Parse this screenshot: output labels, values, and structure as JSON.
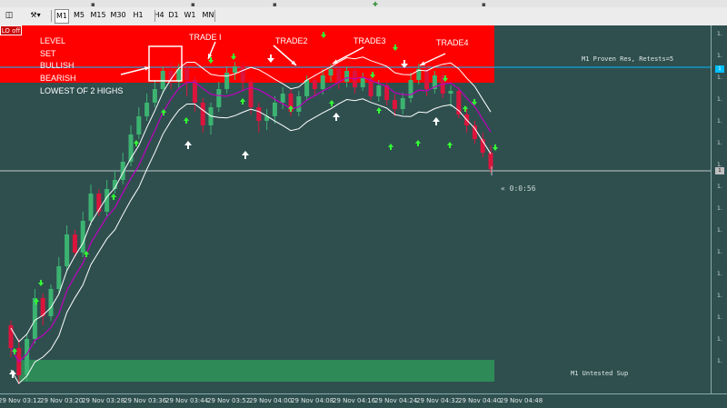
{
  "toolbar": {
    "timeframes": [
      "M1",
      "M5",
      "M15",
      "M30",
      "H1",
      "H4",
      "D1",
      "W1",
      "MN"
    ],
    "active": "M1"
  },
  "solo_button": {
    "label": "LO off"
  },
  "labels": {
    "level": "LEVEL",
    "set": "SET",
    "bullish": "BULLISH",
    "bearish": "BEARISH",
    "lowest": "LOWEST OF 2 HIGHS",
    "trade1": "TRADE I",
    "trade2": "TRADE2",
    "trade3": "TRADE3",
    "trade4": "TRADE4"
  },
  "zones": {
    "resistance_label": "M1 Proven Res, Retests=5",
    "support_label": "M1 Untested Sup",
    "timer": "« 0:0:56"
  },
  "price_axis": {
    "labels": [
      "1.",
      "1.",
      "1.",
      "1.",
      "1.",
      "1.",
      "1.",
      "1.",
      "1.",
      "1.",
      "1.",
      "1.",
      "1.",
      "1.",
      "1.",
      "1."
    ]
  },
  "time_axis": {
    "labels": [
      "29 Nov 03:12",
      "29 Nov 03:20",
      "29 Nov 03:28",
      "29 Nov 03:36",
      "29 Nov 03:44",
      "29 Nov 03:52",
      "29 Nov 04:00",
      "29 Nov 04:08",
      "29 Nov 04:16",
      "29 Nov 04:24",
      "29 Nov 04:32",
      "29 Nov 04:40",
      "29 Nov 04:48"
    ]
  },
  "colors": {
    "background": "#2f4f4f",
    "bull": "#3cb371",
    "bear": "#dc143c",
    "resistance": "#ff0000",
    "support": "#2e8b57",
    "band": "#ffffff",
    "mid": "#c000c0",
    "cyan": "#00bfff"
  },
  "chart_data": {
    "type": "candlestick",
    "candles": [
      {
        "o": 330,
        "c": 355,
        "h": 325,
        "l": 365
      },
      {
        "o": 355,
        "c": 385,
        "h": 345,
        "l": 395
      },
      {
        "o": 385,
        "c": 345,
        "h": 340,
        "l": 392
      },
      {
        "o": 345,
        "c": 300,
        "h": 290,
        "l": 350
      },
      {
        "o": 300,
        "c": 320,
        "h": 295,
        "l": 330
      },
      {
        "o": 320,
        "c": 290,
        "h": 285,
        "l": 325
      },
      {
        "o": 290,
        "c": 265,
        "h": 255,
        "l": 295
      },
      {
        "o": 265,
        "c": 230,
        "h": 220,
        "l": 270
      },
      {
        "o": 230,
        "c": 250,
        "h": 225,
        "l": 255
      },
      {
        "o": 250,
        "c": 215,
        "h": 205,
        "l": 255
      },
      {
        "o": 215,
        "c": 185,
        "h": 175,
        "l": 220
      },
      {
        "o": 185,
        "c": 205,
        "h": 180,
        "l": 210
      },
      {
        "o": 205,
        "c": 180,
        "h": 170,
        "l": 210
      },
      {
        "o": 180,
        "c": 170,
        "h": 160,
        "l": 185
      },
      {
        "o": 170,
        "c": 150,
        "h": 140,
        "l": 175
      },
      {
        "o": 150,
        "c": 120,
        "h": 110,
        "l": 155
      },
      {
        "o": 120,
        "c": 100,
        "h": 90,
        "l": 125
      },
      {
        "o": 100,
        "c": 85,
        "h": 75,
        "l": 105
      },
      {
        "o": 85,
        "c": 70,
        "h": 60,
        "l": 90
      },
      {
        "o": 70,
        "c": 50,
        "h": 45,
        "l": 75
      },
      {
        "o": 50,
        "c": 62,
        "h": 40,
        "l": 70
      },
      {
        "o": 62,
        "c": 48,
        "h": 42,
        "l": 70
      },
      {
        "o": 48,
        "c": 60,
        "h": 40,
        "l": 78
      },
      {
        "o": 60,
        "c": 85,
        "h": 55,
        "l": 95
      },
      {
        "o": 85,
        "c": 110,
        "h": 80,
        "l": 118
      },
      {
        "o": 110,
        "c": 90,
        "h": 85,
        "l": 120
      },
      {
        "o": 90,
        "c": 70,
        "h": 62,
        "l": 95
      },
      {
        "o": 70,
        "c": 52,
        "h": 45,
        "l": 75
      },
      {
        "o": 52,
        "c": 45,
        "h": 40,
        "l": 60
      },
      {
        "o": 45,
        "c": 62,
        "h": 40,
        "l": 72
      },
      {
        "o": 62,
        "c": 90,
        "h": 58,
        "l": 98
      },
      {
        "o": 90,
        "c": 105,
        "h": 85,
        "l": 118
      },
      {
        "o": 105,
        "c": 100,
        "h": 92,
        "l": 115
      },
      {
        "o": 100,
        "c": 85,
        "h": 78,
        "l": 108
      },
      {
        "o": 85,
        "c": 75,
        "h": 68,
        "l": 92
      },
      {
        "o": 75,
        "c": 95,
        "h": 70,
        "l": 100
      },
      {
        "o": 95,
        "c": 78,
        "h": 72,
        "l": 100
      },
      {
        "o": 78,
        "c": 60,
        "h": 55,
        "l": 82
      },
      {
        "o": 60,
        "c": 70,
        "h": 52,
        "l": 78
      },
      {
        "o": 70,
        "c": 55,
        "h": 48,
        "l": 76
      },
      {
        "o": 55,
        "c": 48,
        "h": 42,
        "l": 62
      },
      {
        "o": 48,
        "c": 62,
        "h": 44,
        "l": 70
      },
      {
        "o": 62,
        "c": 50,
        "h": 45,
        "l": 68
      },
      {
        "o": 50,
        "c": 68,
        "h": 46,
        "l": 75
      },
      {
        "o": 68,
        "c": 58,
        "h": 52,
        "l": 72
      },
      {
        "o": 58,
        "c": 78,
        "h": 55,
        "l": 82
      },
      {
        "o": 78,
        "c": 66,
        "h": 60,
        "l": 84
      },
      {
        "o": 66,
        "c": 82,
        "h": 62,
        "l": 88
      },
      {
        "o": 82,
        "c": 92,
        "h": 76,
        "l": 100
      },
      {
        "o": 92,
        "c": 80,
        "h": 74,
        "l": 98
      },
      {
        "o": 80,
        "c": 60,
        "h": 52,
        "l": 85
      },
      {
        "o": 60,
        "c": 48,
        "h": 42,
        "l": 65
      },
      {
        "o": 48,
        "c": 70,
        "h": 45,
        "l": 78
      },
      {
        "o": 70,
        "c": 55,
        "h": 50,
        "l": 75
      },
      {
        "o": 55,
        "c": 75,
        "h": 50,
        "l": 80
      },
      {
        "o": 75,
        "c": 72,
        "h": 66,
        "l": 90
      },
      {
        "o": 72,
        "c": 98,
        "h": 68,
        "l": 102
      },
      {
        "o": 98,
        "c": 110,
        "h": 92,
        "l": 118
      },
      {
        "o": 110,
        "c": 125,
        "h": 105,
        "l": 130
      },
      {
        "o": 125,
        "c": 140,
        "h": 118,
        "l": 145
      },
      {
        "o": 140,
        "c": 158,
        "h": 132,
        "l": 162
      }
    ]
  }
}
